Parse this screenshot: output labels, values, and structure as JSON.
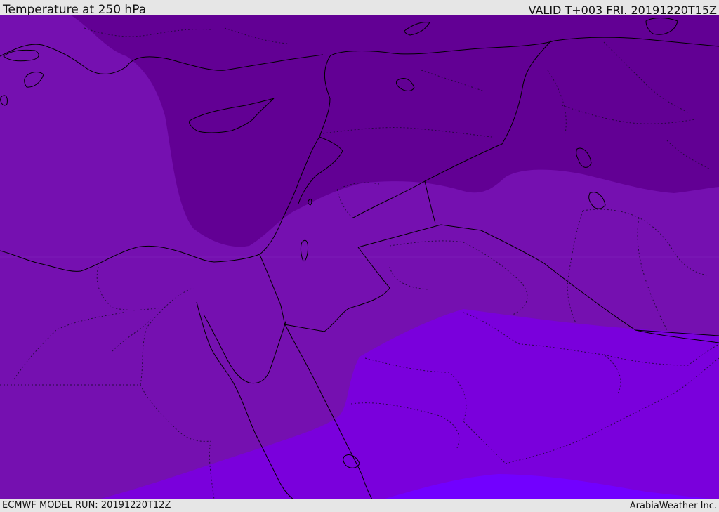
{
  "header": {
    "title": "Temperature at 250 hPa",
    "valid": "VALID T+003 FRI. 20191220T15Z"
  },
  "footer": {
    "model_run": "ECMWF MODEL RUN: 20191220T12Z",
    "credit": "ArabiaWeather Inc."
  },
  "colors": {
    "background": "#e6e6e6",
    "band_coldest": "#620094",
    "band_cold": "#7510b0",
    "band_mid": "#7a00dc",
    "band_warm": "#7200ff",
    "coastline": "#000000"
  }
}
